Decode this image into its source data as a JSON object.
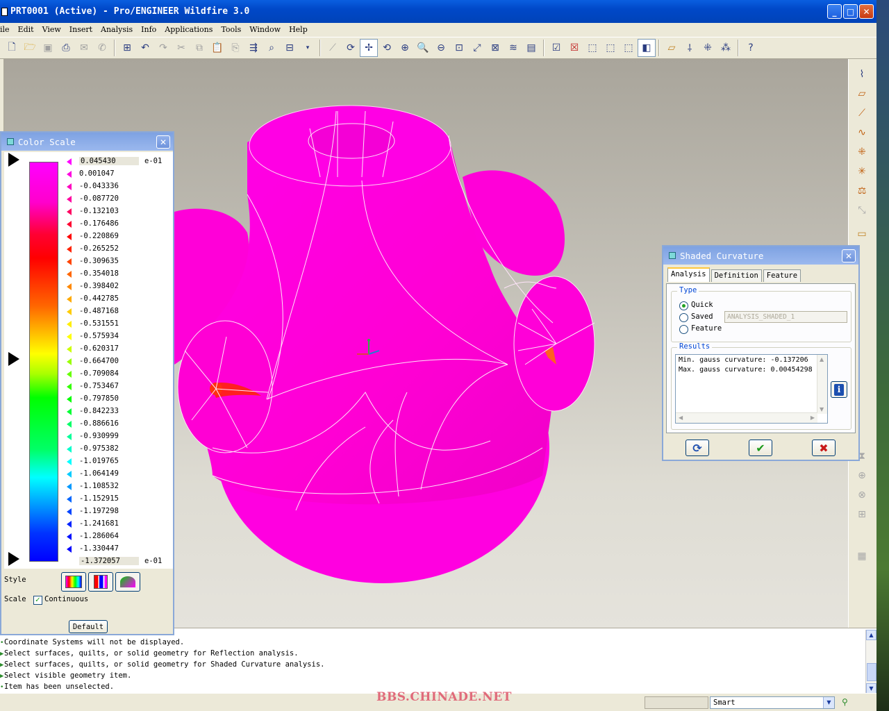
{
  "window": {
    "title": "PRT0001 (Active) - Pro/ENGINEER Wildfire 3.0",
    "minimize": "_",
    "maximize": "□",
    "close": "✕"
  },
  "menu": [
    "ile",
    "Edit",
    "View",
    "Insert",
    "Analysis",
    "Info",
    "Applications",
    "Tools",
    "Window",
    "Help"
  ],
  "color_scale": {
    "title": "Color Scale",
    "close": "✕",
    "top_value": "0.045430",
    "bottom_value": "-1.372057",
    "exponent_top": "e-01",
    "exponent_bottom": "e-01",
    "labels": [
      "0.001047",
      "-0.043336",
      "-0.087720",
      "-0.132103",
      "-0.176486",
      "-0.220869",
      "-0.265252",
      "-0.309635",
      "-0.354018",
      "-0.398402",
      "-0.442785",
      "-0.487168",
      "-0.531551",
      "-0.575934",
      "-0.620317",
      "-0.664700",
      "-0.709084",
      "-0.753467",
      "-0.797850",
      "-0.842233",
      "-0.886616",
      "-0.930999",
      "-0.975382",
      "-1.019765",
      "-1.064149",
      "-1.108532",
      "-1.152915",
      "-1.197298",
      "-1.241681",
      "-1.286064",
      "-1.330447"
    ],
    "marker_colors": [
      "#ff00ff",
      "#ff00e0",
      "#ff00c0",
      "#ff00a0",
      "#ff0060",
      "#ff0030",
      "#ff0000",
      "#ff2200",
      "#ff4400",
      "#ff6600",
      "#ff8800",
      "#ffaa00",
      "#ffcc00",
      "#ffee00",
      "#ffff00",
      "#ccff00",
      "#99ff00",
      "#66ff00",
      "#33ff00",
      "#00ff00",
      "#00ff33",
      "#00ff66",
      "#00ff99",
      "#00ffcc",
      "#00ffff",
      "#00ccff",
      "#0099ff",
      "#0066ff",
      "#0044ff",
      "#0022ff",
      "#0011ff",
      "#0000ff"
    ],
    "style_label": "Style",
    "scale_label": "Scale",
    "continuous_label": "Continuous",
    "continuous_checked": true,
    "default_button": "Default"
  },
  "shaded_curvature": {
    "title": "Shaded Curvature",
    "close": "✕",
    "tabs": [
      "Analysis",
      "Definition",
      "Feature"
    ],
    "type_legend": "Type",
    "type_options": [
      "Quick",
      "Saved",
      "Feature"
    ],
    "type_selected": "Quick",
    "name_value": "ANALYSIS_SHADED_1",
    "results_legend": "Results",
    "results": [
      "Min. gauss curvature: -0.137206",
      "Max. gauss curvature: 0.00454298"
    ],
    "info_label": "i"
  },
  "messages": [
    "Coordinate Systems will not be displayed.",
    "Select surfaces, quilts, or solid geometry for Reflection analysis.",
    "Select surfaces, quilts, or solid geometry for Shaded Curvature analysis.",
    "Select visible geometry item.",
    "Item has been unselected."
  ],
  "status": {
    "watermark": "BBS.CHINADE.NET",
    "filter": "Smart"
  },
  "colors": {
    "model": "#ff00d8",
    "titlebar": "#0050d8"
  }
}
